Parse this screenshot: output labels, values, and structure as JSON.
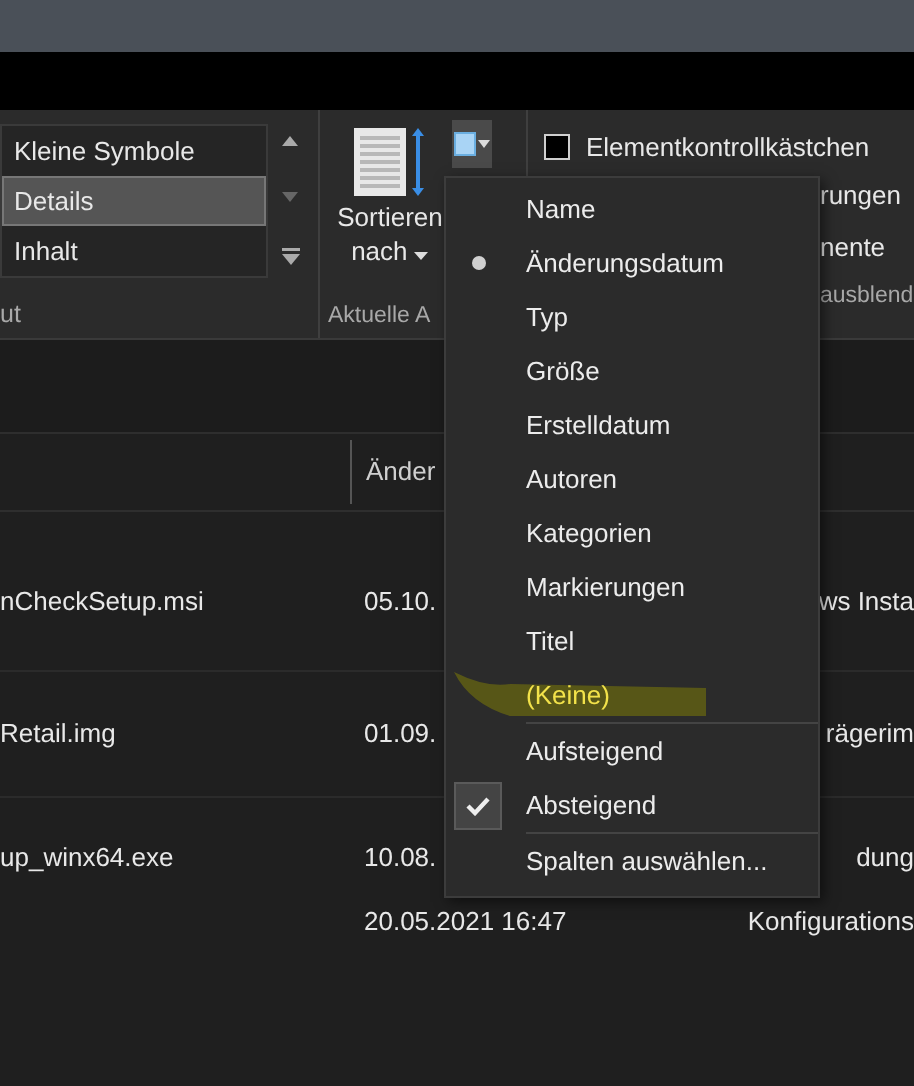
{
  "ribbon": {
    "layout_options": [
      {
        "label": "Kleine Symbole",
        "selected": false
      },
      {
        "label": "Details",
        "selected": true
      },
      {
        "label": "Inhalt",
        "selected": false
      }
    ],
    "layout_group_label": "ut",
    "sort_button": {
      "label": "Sortieren",
      "sublabel": "nach"
    },
    "current_view_group_label": "Aktuelle A",
    "checkbox": {
      "label": "Elementkontrollkästchen",
      "checked": false
    },
    "show_hide_items": [
      "rungen",
      "nente"
    ],
    "show_hide_group_label": "ausblend"
  },
  "file_list": {
    "columns": [
      "Änder"
    ],
    "rows": [
      {
        "name": "nCheckSetup.msi",
        "date": "05.10.",
        "type": "ws Insta"
      },
      {
        "name": "Retail.img",
        "date": "01.09.",
        "type": "rägerim"
      },
      {
        "name": "up_winx64.exe",
        "date": "10.08.",
        "type": "dung"
      },
      {
        "name": "",
        "date": "20.05.2021 16:47",
        "type": "Konfigurations"
      }
    ]
  },
  "sort_menu": {
    "columns": [
      {
        "label": "Name",
        "selected": false,
        "highlighted": false
      },
      {
        "label": "Änderungsdatum",
        "selected": true,
        "highlighted": false
      },
      {
        "label": "Typ",
        "selected": false,
        "highlighted": false
      },
      {
        "label": "Größe",
        "selected": false,
        "highlighted": false
      },
      {
        "label": "Erstelldatum",
        "selected": false,
        "highlighted": false
      },
      {
        "label": "Autoren",
        "selected": false,
        "highlighted": false
      },
      {
        "label": "Kategorien",
        "selected": false,
        "highlighted": false
      },
      {
        "label": "Markierungen",
        "selected": false,
        "highlighted": false
      },
      {
        "label": "Titel",
        "selected": false,
        "highlighted": false
      },
      {
        "label": "(Keine)",
        "selected": false,
        "highlighted": true
      }
    ],
    "order": [
      {
        "label": "Aufsteigend",
        "selected": false
      },
      {
        "label": "Absteigend",
        "selected": true
      }
    ],
    "choose_columns": "Spalten auswählen..."
  }
}
